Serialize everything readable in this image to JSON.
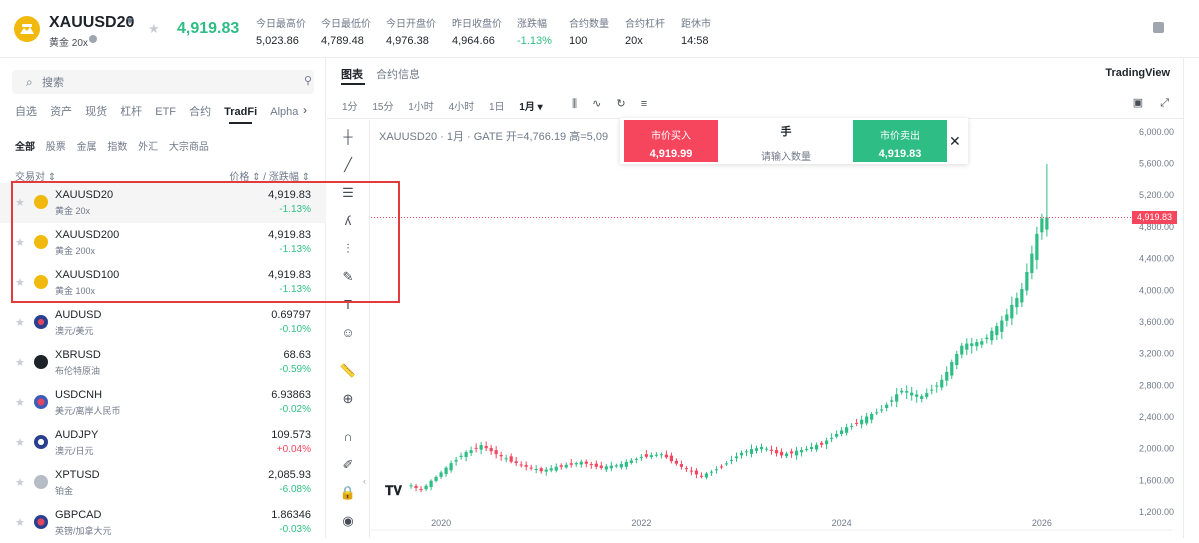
{
  "header": {
    "symbol": "XAUUSD20",
    "subtitle": "黄金 20x",
    "last_price": "4,919.83",
    "stats": [
      {
        "label": "今日最高价",
        "value": "5,023.86"
      },
      {
        "label": "今日最低价",
        "value": "4,789.48"
      },
      {
        "label": "今日开盘价",
        "value": "4,976.38"
      },
      {
        "label": "昨日收盘价",
        "value": "4,964.66"
      },
      {
        "label": "涨跌幅",
        "value": "-1.13%"
      },
      {
        "label": "合约数量",
        "value": "100"
      },
      {
        "label": "合约杠杆",
        "value": "20x"
      },
      {
        "label": "距休市",
        "value": "14:58"
      }
    ]
  },
  "sidebar": {
    "search_placeholder": "搜索",
    "category_tabs": [
      "自选",
      "资产",
      "现货",
      "杠杆",
      "ETF",
      "合约",
      "TradFi",
      "Alpha"
    ],
    "active_category": "TradFi",
    "sub_tabs": [
      "全部",
      "股票",
      "金属",
      "指数",
      "外汇",
      "大宗商品"
    ],
    "active_sub_tab": "全部",
    "col_pair": "交易对 ⇕",
    "col_price": "价格 ⇕ / 涨跌幅 ⇕",
    "rows": [
      {
        "name": "XAUUSD20",
        "sub": "黄金 20x",
        "price": "4,919.83",
        "change": "-1.13%",
        "dir": "down"
      },
      {
        "name": "XAUUSD200",
        "sub": "黄金 200x",
        "price": "4,919.83",
        "change": "-1.13%",
        "dir": "down"
      },
      {
        "name": "XAUUSD100",
        "sub": "黄金 100x",
        "price": "4,919.83",
        "change": "-1.13%",
        "dir": "down"
      },
      {
        "name": "AUDUSD",
        "sub": "澳元/美元",
        "price": "0.69797",
        "change": "-0.10%",
        "dir": "down"
      },
      {
        "name": "XBRUSD",
        "sub": "布伦特原油",
        "price": "68.63",
        "change": "-0.59%",
        "dir": "down"
      },
      {
        "name": "USDCNH",
        "sub": "美元/离岸人民币",
        "price": "6.93863",
        "change": "-0.02%",
        "dir": "down"
      },
      {
        "name": "AUDJPY",
        "sub": "澳元/日元",
        "price": "109.573",
        "change": "+0.04%",
        "dir": "up"
      },
      {
        "name": "XPTUSD",
        "sub": "铂金",
        "price": "2,085.93",
        "change": "-6.08%",
        "dir": "down"
      },
      {
        "name": "GBPCAD",
        "sub": "英镑/加拿大元",
        "price": "1.86346",
        "change": "-0.03%",
        "dir": "down"
      }
    ]
  },
  "chart_panel": {
    "tabs": [
      "图表",
      "合约信息"
    ],
    "active_tab": "图表",
    "brand": "TradingView",
    "intervals": [
      "1分",
      "15分",
      "1小时",
      "4小时",
      "1日",
      "1月 ▾"
    ],
    "active_interval": "1月 ▾",
    "title": "XAUUSD20 · 1月 · GATE  开=4,766.19  高=5,09",
    "order": {
      "buy_label": "市价买入",
      "buy_price": "4,919.99",
      "unit": "手",
      "qty_placeholder": "请输入数量",
      "sell_label": "市价卖出",
      "sell_price": "4,919.83"
    },
    "current_price_tag": "4,919.83"
  },
  "chart_data": {
    "type": "candlestick",
    "title": "XAUUSD20 · 1月 · GATE",
    "x_ticks": [
      "2020",
      "2022",
      "2024",
      "2026"
    ],
    "y_ticks": [
      6000,
      5600,
      5200,
      4800,
      4400,
      4000,
      3600,
      3200,
      2800,
      2400,
      2000,
      1600,
      1200
    ],
    "ylim": [
      1100,
      6150
    ],
    "x_range": [
      2019.3,
      2026.9
    ],
    "current_price": 4919.83,
    "series": [
      {
        "name": "monthly",
        "points": [
          [
            2019.05,
            1520
          ],
          [
            2019.25,
            1600
          ],
          [
            2019.45,
            1650
          ],
          [
            2019.65,
            1580
          ],
          [
            2019.85,
            1480
          ],
          [
            2020.05,
            1700
          ],
          [
            2020.25,
            1920
          ],
          [
            2020.45,
            2040
          ],
          [
            2020.65,
            1900
          ],
          [
            2020.85,
            1790
          ],
          [
            2021.05,
            1720
          ],
          [
            2021.25,
            1780
          ],
          [
            2021.45,
            1830
          ],
          [
            2021.65,
            1760
          ],
          [
            2021.85,
            1800
          ],
          [
            2022.05,
            1900
          ],
          [
            2022.25,
            1930
          ],
          [
            2022.45,
            1770
          ],
          [
            2022.65,
            1650
          ],
          [
            2022.85,
            1780
          ],
          [
            2023.05,
            1950
          ],
          [
            2023.25,
            2020
          ],
          [
            2023.45,
            1920
          ],
          [
            2023.65,
            1980
          ],
          [
            2023.85,
            2060
          ],
          [
            2024.05,
            2230
          ],
          [
            2024.25,
            2360
          ],
          [
            2024.45,
            2500
          ],
          [
            2024.65,
            2740
          ],
          [
            2024.85,
            2650
          ],
          [
            2025.05,
            2860
          ],
          [
            2025.25,
            3300
          ],
          [
            2025.45,
            3350
          ],
          [
            2025.65,
            3600
          ],
          [
            2025.85,
            4000
          ],
          [
            2026.05,
            4919.83
          ]
        ]
      }
    ]
  }
}
